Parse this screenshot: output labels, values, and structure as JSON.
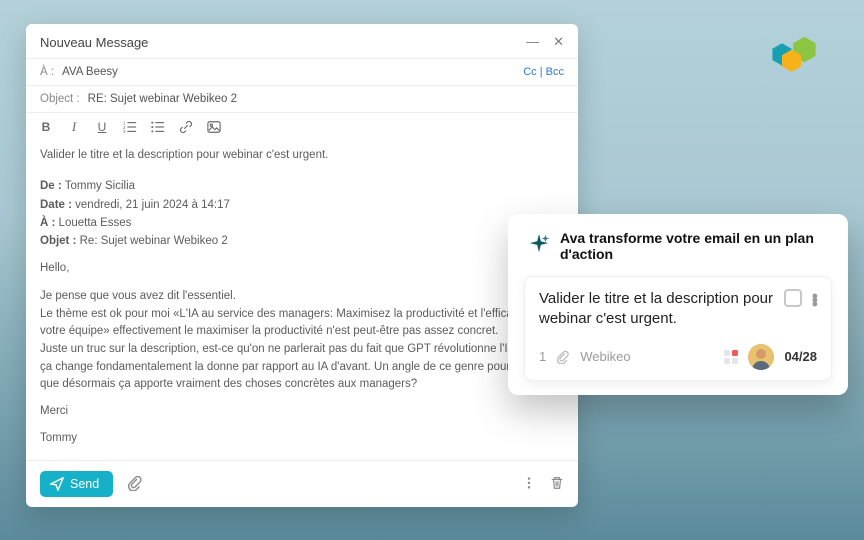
{
  "compose": {
    "title": "Nouveau Message",
    "to_label": "À :",
    "to_value": "AVA Beesy",
    "cc_label": "Cc",
    "bcc_label": "Bcc",
    "subject_label": "Object :",
    "subject_value": "RE: Sujet webinar Webikeo 2",
    "body_first": "Valider le titre et la description pour webinar c'est urgent.",
    "from_label": "De :",
    "from_value": "Tommy Sicilia",
    "date_label": "Date :",
    "date_value": "vendredi, 21 juin 2024 à 14:17",
    "to2_label": "À :",
    "to2_value": "Louetta Esses",
    "subject2_label": "Objet :",
    "subject2_value": "Re: Sujet webinar Webikeo 2",
    "greeting": "Hello,",
    "para1": "Je pense que vous avez dit l'essentiel.",
    "para2": "Le thème est ok pour moi «L'IA au service des managers: Maximisez la productivité et l'efficacité de votre équipe» effectivement le maximiser la productivité n'est peut-être pas assez concret.",
    "para3": "Juste un truc sur la description, est-ce qu'on ne parlerait pas du fait que GPT révolutionne l'IA et que ça change fondamentalement la donne par rapport au IA d'avant. Un angle de ce genre pour montrer que désormais ça apporte vraiment des choses concrètes aux managers?",
    "merci": "Merci",
    "signature": "Tommy",
    "send_label": "Send"
  },
  "ava": {
    "header": "Ava transforme votre email en un plan d'action",
    "task_text": "Valider le titre et la description pour webinar c'est urgent.",
    "count": "1",
    "project": "Webikeo",
    "date": "04/28"
  }
}
